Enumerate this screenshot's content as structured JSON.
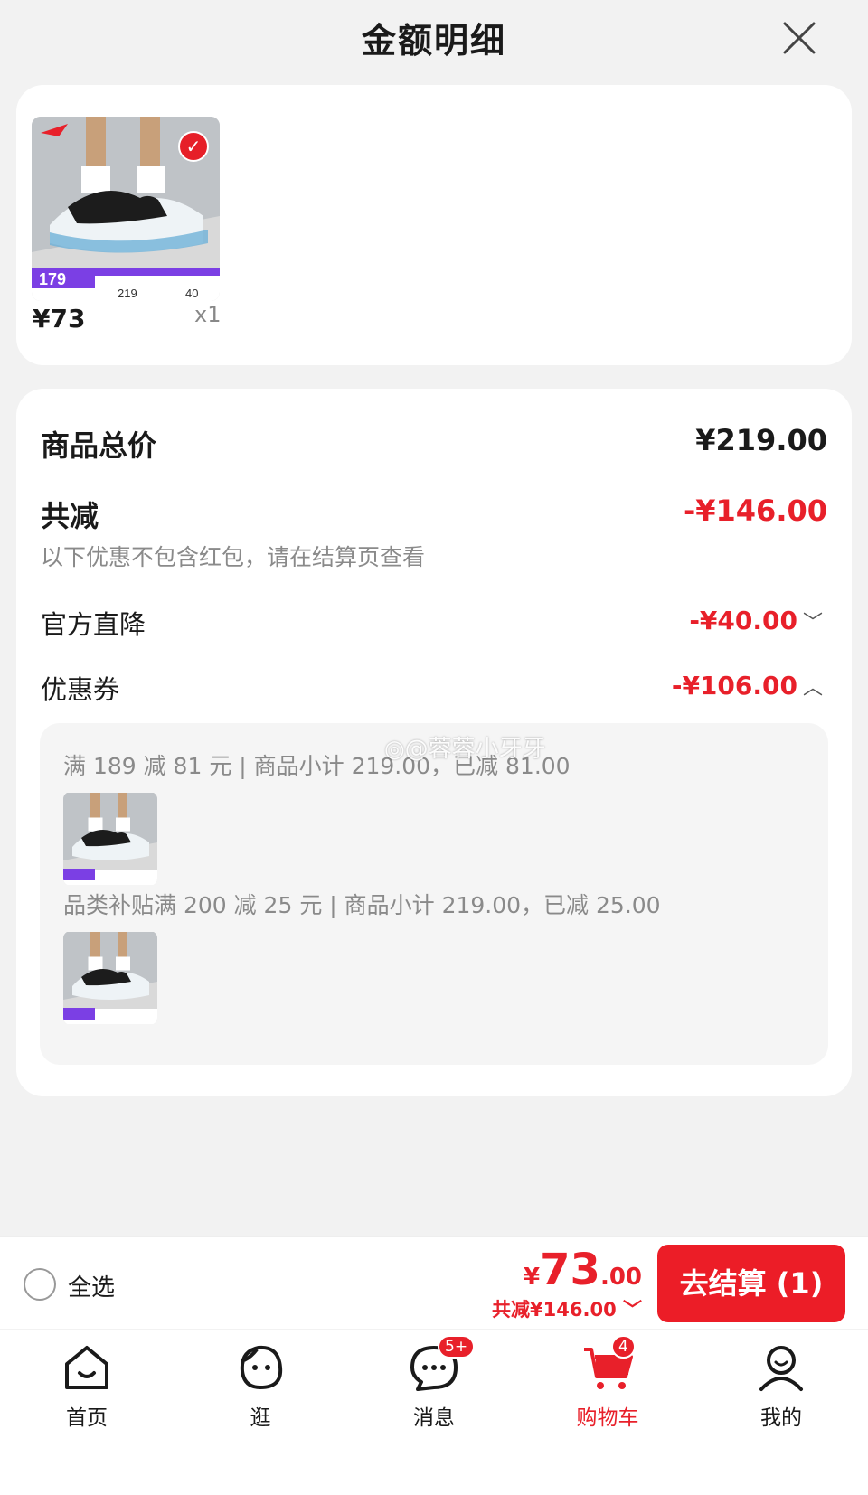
{
  "header": {
    "title": "金额明细"
  },
  "item": {
    "price": "¥73",
    "qty": "x1",
    "badge_price": "179",
    "tag1": "219",
    "tag2": "40"
  },
  "summary": {
    "total_label": "商品总价",
    "total_value": "¥219.00",
    "reduce_label": "共减",
    "reduce_value": "-¥146.00",
    "note": "以下优惠不包含红包，请在结算页查看",
    "official_label": "官方直降",
    "official_value": "-¥40.00",
    "coupon_label": "优惠券",
    "coupon_value": "-¥106.00"
  },
  "coupons": [
    {
      "text": "满 189 减 81 元 | 商品小计 219.00，已减 81.00"
    },
    {
      "text": "品类补贴满 200 减 25 元 | 商品小计 219.00，已减 25.00"
    }
  ],
  "watermark": "◎@蓉蓉小牙牙",
  "bottom": {
    "select_all": "全选",
    "yen": "¥",
    "total_int": "73",
    "total_dec": ".00",
    "total_reduce": "共减¥146.00",
    "checkout": "去结算 (1)"
  },
  "tabs": [
    {
      "label": "首页",
      "icon": "home-icon"
    },
    {
      "label": "逛",
      "icon": "face-icon"
    },
    {
      "label": "消息",
      "icon": "chat-icon",
      "badge": "5+"
    },
    {
      "label": "购物车",
      "icon": "cart-icon",
      "badge": "4"
    },
    {
      "label": "我的",
      "icon": "user-icon"
    }
  ],
  "colors": {
    "accent": "#e8202a",
    "background": "#f2f2f2"
  }
}
